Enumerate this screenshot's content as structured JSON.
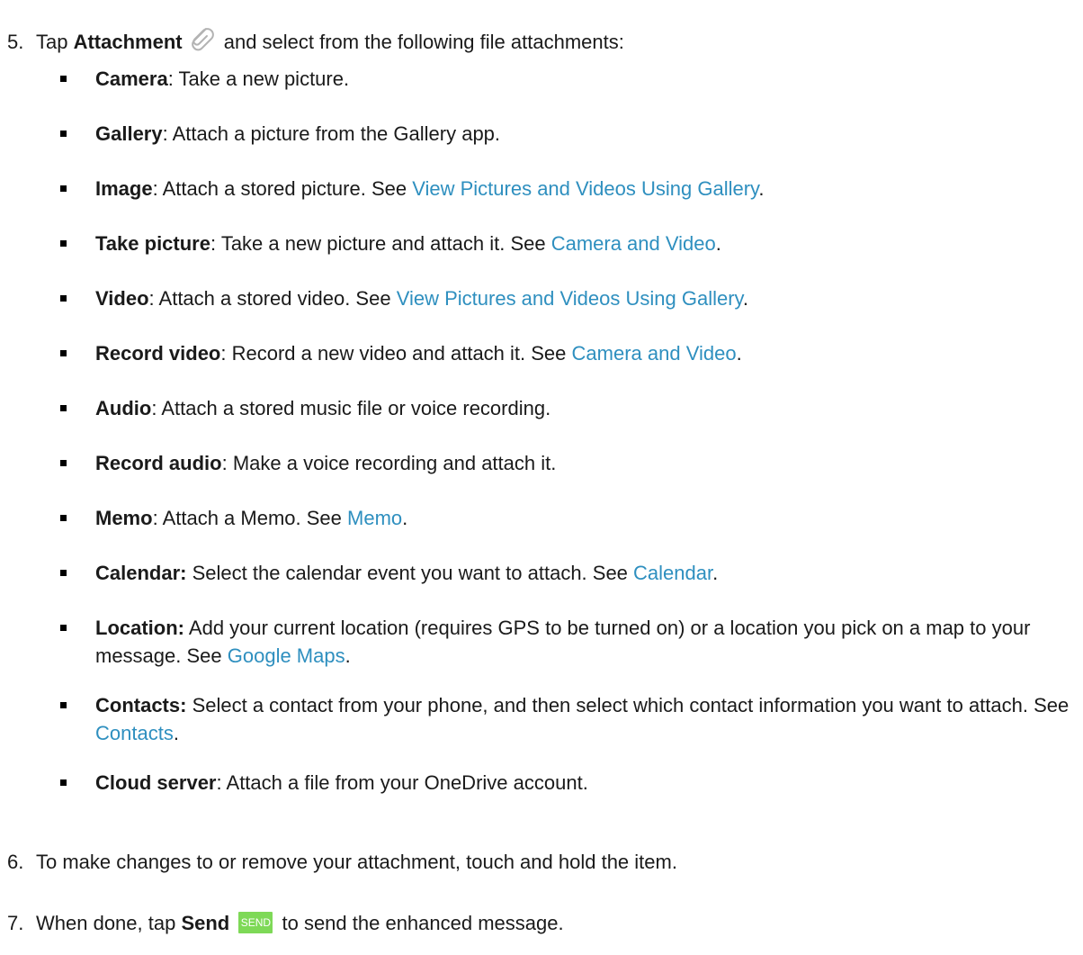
{
  "steps": {
    "s5": {
      "num": "5.",
      "pre": "Tap ",
      "term": "Attachment",
      "icon": "paperclip-icon",
      "post": " and select from the following file attachments:"
    },
    "s6": {
      "num": "6.",
      "text": "To make changes to or remove your attachment, touch and hold the item."
    },
    "s7": {
      "num": "7.",
      "pre": "When done, tap ",
      "term": "Send",
      "button_label": "SEND",
      "post": " to send the enhanced message."
    }
  },
  "attachments": [
    {
      "term": "Camera",
      "sep": ": ",
      "text": "Take a new picture.",
      "link": "",
      "end": ""
    },
    {
      "term": "Gallery",
      "sep": ": ",
      "text": "Attach a picture from the Gallery app.",
      "link": "",
      "end": ""
    },
    {
      "term": "Image",
      "sep": ": ",
      "text": "Attach a stored picture. See ",
      "link": "View Pictures and Videos Using Gallery",
      "end": "."
    },
    {
      "term": "Take picture",
      "sep": ": ",
      "text": "Take a new picture and attach it. See ",
      "link": "Camera and Video",
      "end": "."
    },
    {
      "term": "Video",
      "sep": ": ",
      "text": "Attach a stored video. See ",
      "link": "View Pictures and Videos Using Gallery",
      "end": "."
    },
    {
      "term": "Record video",
      "sep": ": ",
      "text": "Record a new video and attach it. See ",
      "link": "Camera and Video",
      "end": "."
    },
    {
      "term": "Audio",
      "sep": ": ",
      "text": "Attach a stored music file or voice recording.",
      "link": "",
      "end": ""
    },
    {
      "term": "Record audio",
      "sep": ": ",
      "text": "Make a voice recording and attach it.",
      "link": "",
      "end": ""
    },
    {
      "term": "Memo",
      "sep": ": ",
      "text": "Attach a Memo. See ",
      "link": "Memo",
      "end": "."
    },
    {
      "term": "Calendar:",
      "sep": " ",
      "text": "Select the calendar event you want to attach. See ",
      "link": "Calendar",
      "end": "."
    },
    {
      "term": "Location:",
      "sep": " ",
      "text": "Add your current location (requires GPS to be turned on) or a location you pick on a map to your message. See ",
      "link": "Google Maps",
      "end": "."
    },
    {
      "term": "Contacts:",
      "sep": " ",
      "text": "Select a contact from your phone, and then select which contact information you want to attach. See ",
      "link": "Contacts",
      "end": "."
    },
    {
      "term": "Cloud server",
      "sep": ": ",
      "text": "Attach a file from your OneDrive account.",
      "link": "",
      "end": ""
    }
  ],
  "colors": {
    "link": "#2e8fbf",
    "send_button": "#7ed957",
    "text": "#1a1a1a"
  }
}
